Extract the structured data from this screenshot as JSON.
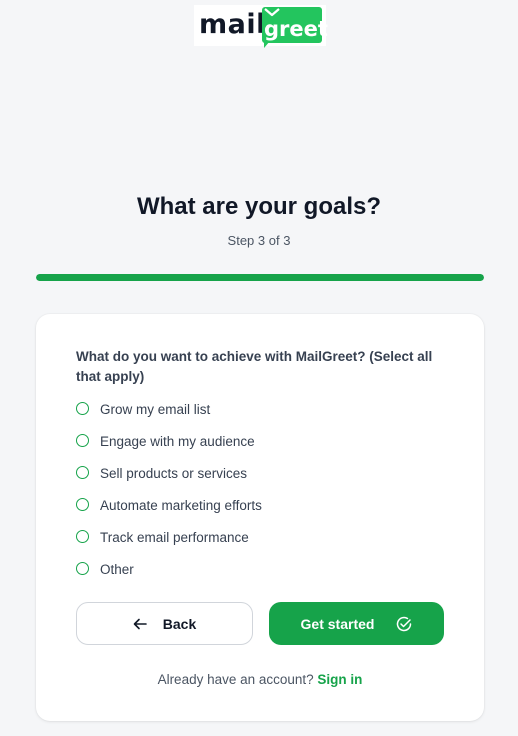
{
  "logo": {
    "part1": "mail",
    "part2": "greet",
    "brand_green": "#23c55e"
  },
  "header": {
    "title": "What are your goals?",
    "step": "Step 3 of 3"
  },
  "progress": {
    "current_step": 3,
    "total_steps": 3,
    "fraction": 1.0,
    "color": "#16a34a"
  },
  "form": {
    "question": "What do you want to achieve with MailGreet? (Select all that apply)",
    "options": [
      {
        "label": "Grow my email list",
        "selected": false
      },
      {
        "label": "Engage with my audience",
        "selected": false
      },
      {
        "label": "Sell products or services",
        "selected": false
      },
      {
        "label": "Automate marketing efforts",
        "selected": false
      },
      {
        "label": "Track email performance",
        "selected": false
      },
      {
        "label": "Other",
        "selected": false
      }
    ]
  },
  "buttons": {
    "back_label": "Back",
    "back_icon": "arrow-left-icon",
    "start_label": "Get started",
    "start_icon": "check-circle-icon"
  },
  "footer": {
    "prompt": "Already have an account?",
    "signin_label": "Sign in"
  },
  "colors": {
    "accent": "#16a34a",
    "background": "#f5f6f8"
  }
}
